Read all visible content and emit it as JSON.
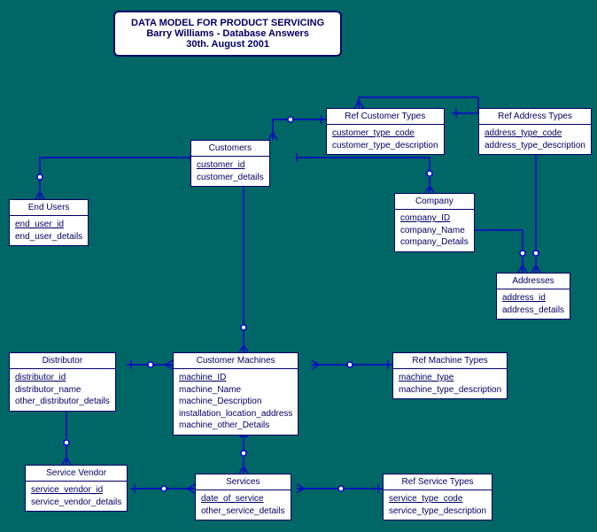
{
  "title": {
    "line1": "DATA MODEL FOR PRODUCT SERVICING",
    "line2": "Barry Williams - Database Answers",
    "line3": "30th. August 2001"
  },
  "entities": {
    "ref_cust_types": {
      "name": "Ref Customer Types",
      "pk": "customer_type_code",
      "attrs": [
        "customer_type_description"
      ]
    },
    "ref_addr_types": {
      "name": "Ref Address Types",
      "pk": "address_type_code",
      "attrs": [
        "address_type_description"
      ]
    },
    "customers": {
      "name": "Customers",
      "pk": "customer_id",
      "attrs": [
        "customer_details"
      ]
    },
    "end_users": {
      "name": "End Users",
      "pk": "end_user_id",
      "attrs": [
        "end_user_details"
      ]
    },
    "company": {
      "name": "Company",
      "pk": "company_ID",
      "attrs": [
        "company_Name",
        "company_Details"
      ]
    },
    "addresses": {
      "name": "Addresses",
      "pk": "address_id",
      "attrs": [
        "address_details"
      ]
    },
    "distributor": {
      "name": "Distributor",
      "pk": "distributor_id",
      "attrs": [
        "distributor_name",
        "other_distributor_details"
      ]
    },
    "customer_machines": {
      "name": "Customer Machines",
      "pk": "machine_ID",
      "attrs": [
        "machine_Name",
        "machine_Description",
        "installation_location_address",
        "machine_other_Details"
      ]
    },
    "ref_machine_types": {
      "name": "Ref Machine Types",
      "pk": "machine_type",
      "attrs": [
        "machine_type_description"
      ]
    },
    "service_vendor": {
      "name": "Service Vendor",
      "pk": "service_vendor_id",
      "attrs": [
        "service_vendor_details"
      ]
    },
    "services": {
      "name": "Services",
      "pk": "date_of_service",
      "attrs": [
        "other_service_details"
      ]
    },
    "ref_service_types": {
      "name": "Ref Service Types",
      "pk": "service_type_code",
      "attrs": [
        "service_type_description"
      ]
    }
  }
}
